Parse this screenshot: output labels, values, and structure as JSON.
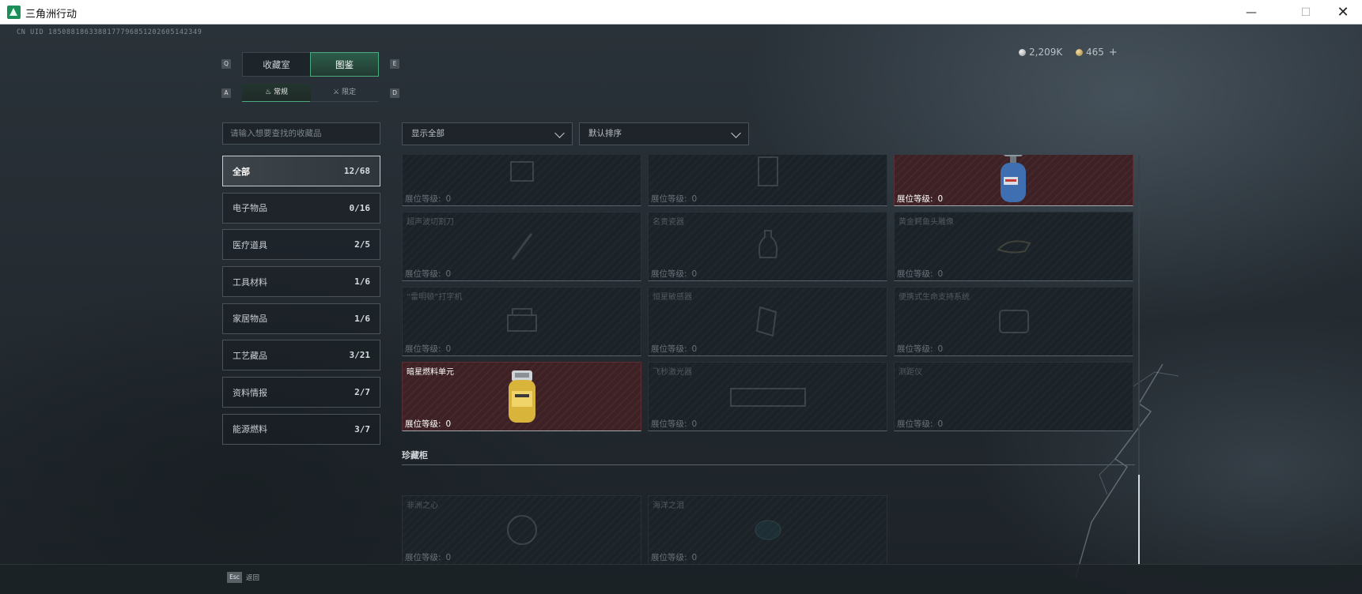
{
  "window": {
    "title": "三角洲行动",
    "minimize": "—",
    "maximize": "☐",
    "close": "✕"
  },
  "uid": "CN UID 1850881863388177796851202605142349",
  "currency": {
    "silver": "2,209K",
    "gold": "465",
    "add": "+"
  },
  "tabs": {
    "main": [
      {
        "label": "收藏室",
        "key": "Q"
      },
      {
        "label": "图鉴",
        "key": "E",
        "active": true
      }
    ],
    "sub": [
      {
        "label": "常规",
        "key": "A",
        "icon": "flame-icon",
        "glyph": "♨",
        "active": true
      },
      {
        "label": "限定",
        "key": "D",
        "icon": "limited-icon",
        "glyph": "⚔"
      }
    ]
  },
  "search": {
    "placeholder": "请输入想要查找的收藏品"
  },
  "filters": {
    "display": "显示全部",
    "sort": "默认排序"
  },
  "categories": [
    {
      "label": "全部",
      "count": "12/68",
      "active": true
    },
    {
      "label": "电子物品",
      "count": "0/16"
    },
    {
      "label": "医疗道具",
      "count": "2/5"
    },
    {
      "label": "工具材料",
      "count": "1/6"
    },
    {
      "label": "家居物品",
      "count": "1/6"
    },
    {
      "label": "工艺藏品",
      "count": "3/21"
    },
    {
      "label": "资料情报",
      "count": "2/7"
    },
    {
      "label": "能源燃料",
      "count": "3/7"
    }
  ],
  "level_label": "展位等级:",
  "items": [
    {
      "name": "",
      "level": "0",
      "owned": false,
      "icon": "device-icon"
    },
    {
      "name": "",
      "level": "0",
      "owned": false,
      "icon": "machine-icon"
    },
    {
      "name": "",
      "level": "0",
      "owned": true,
      "icon": "gas-canister-icon"
    },
    {
      "name": "超声波切割刀",
      "level": "0",
      "owned": false,
      "icon": "knife-icon"
    },
    {
      "name": "名贵瓷器",
      "level": "0",
      "owned": false,
      "icon": "vase-icon"
    },
    {
      "name": "黄金鳄鱼头雕像",
      "level": "0",
      "owned": false,
      "icon": "statue-icon"
    },
    {
      "name": "“雷明顿”打字机",
      "level": "0",
      "owned": false,
      "icon": "typewriter-icon"
    },
    {
      "name": "恒星敏感器",
      "level": "0",
      "owned": false,
      "icon": "sensor-icon"
    },
    {
      "name": "便携式生命支持系统",
      "level": "0",
      "owned": false,
      "icon": "life-support-icon"
    },
    {
      "name": "暗星燃料单元",
      "level": "0",
      "owned": true,
      "icon": "fuel-cell-icon"
    },
    {
      "name": "飞秒激光器",
      "level": "0",
      "owned": false,
      "icon": "laser-icon"
    },
    {
      "name": "测距仪",
      "level": "0",
      "owned": false,
      "icon": "rangefinder-icon"
    }
  ],
  "treasure": {
    "title": "珍藏柜",
    "items": [
      {
        "name": "非洲之心",
        "level": "0",
        "owned": false,
        "icon": "diamond-icon"
      },
      {
        "name": "海洋之泪",
        "level": "0",
        "owned": false,
        "icon": "gem-icon"
      }
    ]
  },
  "footer": {
    "esc_key": "Esc",
    "esc_label": "返回"
  }
}
